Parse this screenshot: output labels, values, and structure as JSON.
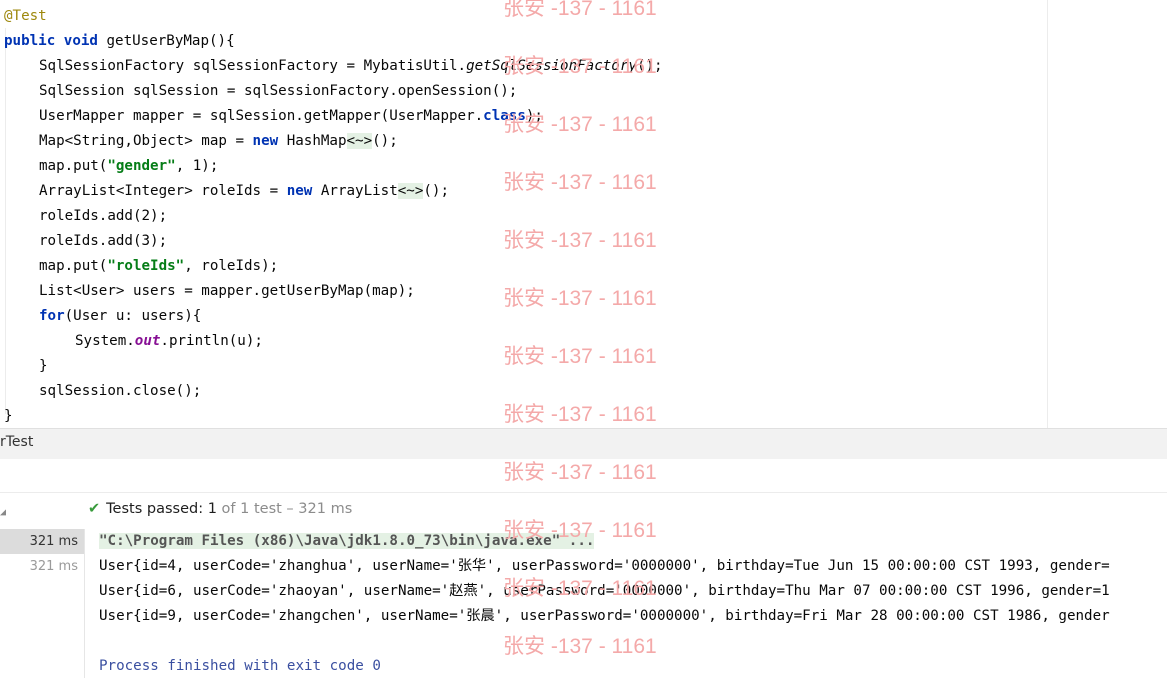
{
  "editor": {
    "annotation": "@Test",
    "lines": {
      "l1_kw": "public void",
      "l1_rest": " getUserByMap(){",
      "l2_a": "SqlSessionFactory sqlSessionFactory = MybatisUtil.",
      "l2_b": "getSqlSessionFactory",
      "l2_c": "();",
      "l3": "SqlSession sqlSession = sqlSessionFactory.openSession();",
      "l4_a": "UserMapper mapper = sqlSession.getMapper(UserMapper.",
      "l4_b": "class",
      "l4_c": ");",
      "l5_a": "Map<String,Object> map = ",
      "l5_kw": "new",
      "l5_b": " HashMap",
      "l5_d": "<~>",
      "l5_c": "();",
      "l6_a": "map.put(",
      "l6_s": "\"gender\"",
      "l6_b": ", 1);",
      "l7_a": "ArrayList<Integer> roleIds = ",
      "l7_kw": "new",
      "l7_b": " ArrayList",
      "l7_d": "<~>",
      "l7_c": "();",
      "l8": "roleIds.add(2);",
      "l9": "roleIds.add(3);",
      "l10_a": "map.put(",
      "l10_s": "\"roleIds\"",
      "l10_b": ", roleIds);",
      "l11": "List<User> users = mapper.getUserByMap(map);",
      "l12_kw": "for",
      "l12_b": "(User u: users){",
      "l13_a": "System.",
      "l13_f": "out",
      "l13_b": ".println(u);",
      "l14": "}",
      "l15": "sqlSession.close();",
      "l16": "}"
    }
  },
  "run_tab": {
    "label": "rTest"
  },
  "test_status": {
    "check_icon": "check-icon",
    "label": "Tests passed: ",
    "passed": "1",
    "of_text": " of 1 test – 321 ms"
  },
  "timings": [
    "321 ms",
    "321 ms"
  ],
  "console": {
    "command": "\"C:\\Program Files (x86)\\Java\\jdk1.8.0_73\\bin\\java.exe\" ...",
    "lines": [
      "User{id=4, userCode='zhanghua', userName='张华', userPassword='0000000', birthday=Tue Jun 15 00:00:00 CST 1993, gender=",
      "User{id=6, userCode='zhaoyan', userName='赵燕', userPassword='0000000', birthday=Thu Mar 07 00:00:00 CST 1996, gender=1",
      "User{id=9, userCode='zhangchen', userName='张晨', userPassword='0000000', birthday=Fri Mar 28 00:00:00 CST 1986, gender"
    ],
    "exit": "Process finished with exit code 0"
  },
  "watermark": {
    "text": "张安 -137 - 1161"
  },
  "colors": {
    "keyword": "#0033b3",
    "string": "#067d17",
    "annotation": "#9e880d",
    "pass": "#389b3c",
    "watermark": "#f4a9a9"
  }
}
